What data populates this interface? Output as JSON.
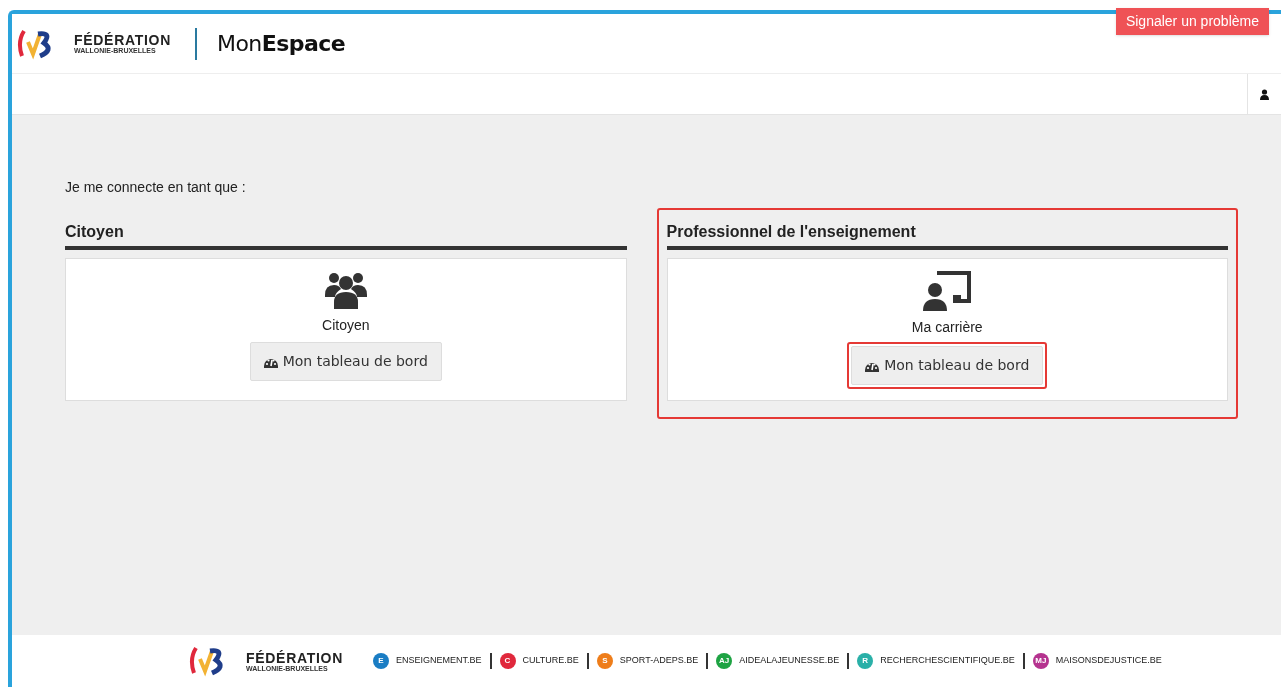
{
  "header": {
    "logo_title": "FÉDÉRATION",
    "logo_subtitle": "WALLONIE-BRUXELLES",
    "app_name_light": "Mon",
    "app_name_bold": "Espace",
    "report_button": "Signaler un problème"
  },
  "intro": "Je me connecte en tant que :",
  "sections": [
    {
      "kind": "people",
      "title": "Citoyen",
      "highlighted": false,
      "card_label": "Citoyen",
      "button": {
        "label": "Mon tableau de bord",
        "highlighted": false
      }
    },
    {
      "kind": "teacher",
      "title": "Professionnel de l'enseignement",
      "highlighted": true,
      "card_label": "Ma carrière",
      "button": {
        "label": "Mon tableau de bord",
        "highlighted": true
      }
    }
  ],
  "footer": {
    "logo_title": "FÉDÉRATION",
    "logo_subtitle": "WALLONIE-BRUXELLES",
    "links": [
      {
        "badge": "E",
        "label": "ENSEIGNEMENT.BE",
        "color": "#1a7dc4"
      },
      {
        "badge": "C",
        "label": "CULTURE.BE",
        "color": "#e0283c"
      },
      {
        "badge": "S",
        "label": "SPORT-ADEPS.BE",
        "color": "#ee7d1a"
      },
      {
        "badge": "AJ",
        "label": "AIDEALAJEUNESSE.BE",
        "color": "#1ea343"
      },
      {
        "badge": "R",
        "label": "RECHERCHESCIENTIFIQUE.BE",
        "color": "#2ab0a8"
      },
      {
        "badge": "MJ",
        "label": "MAISONSDEJUSTICE.BE",
        "color": "#b5338f"
      }
    ]
  }
}
